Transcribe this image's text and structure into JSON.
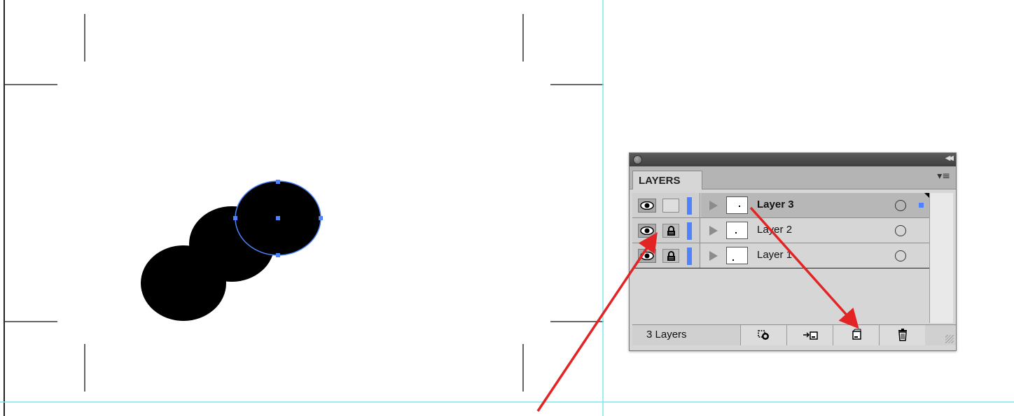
{
  "colors": {
    "guide": "#7de8ee",
    "selection": "#4f82ff",
    "arrow": "#e32424",
    "shape_fill": "#000000"
  },
  "layers_panel": {
    "tab_label": "LAYERS",
    "collapse_icon": "collapse-double-chevron-icon",
    "menu_icon": "panel-menu-icon",
    "layers": [
      {
        "name": "Layer 3",
        "visible": true,
        "locked": false,
        "selected": true
      },
      {
        "name": "Layer 2",
        "visible": true,
        "locked": true,
        "selected": false
      },
      {
        "name": "Layer 1",
        "visible": true,
        "locked": true,
        "selected": false
      }
    ],
    "footer": {
      "layer_count": "3 Layers",
      "buttons": [
        "make-clipping-mask-icon",
        "create-sublayer-icon",
        "create-new-layer-icon",
        "delete-layer-icon"
      ]
    }
  },
  "annotations": {
    "arrows": [
      "arrow-to-lock-toggle",
      "arrow-to-new-layer-button"
    ]
  }
}
